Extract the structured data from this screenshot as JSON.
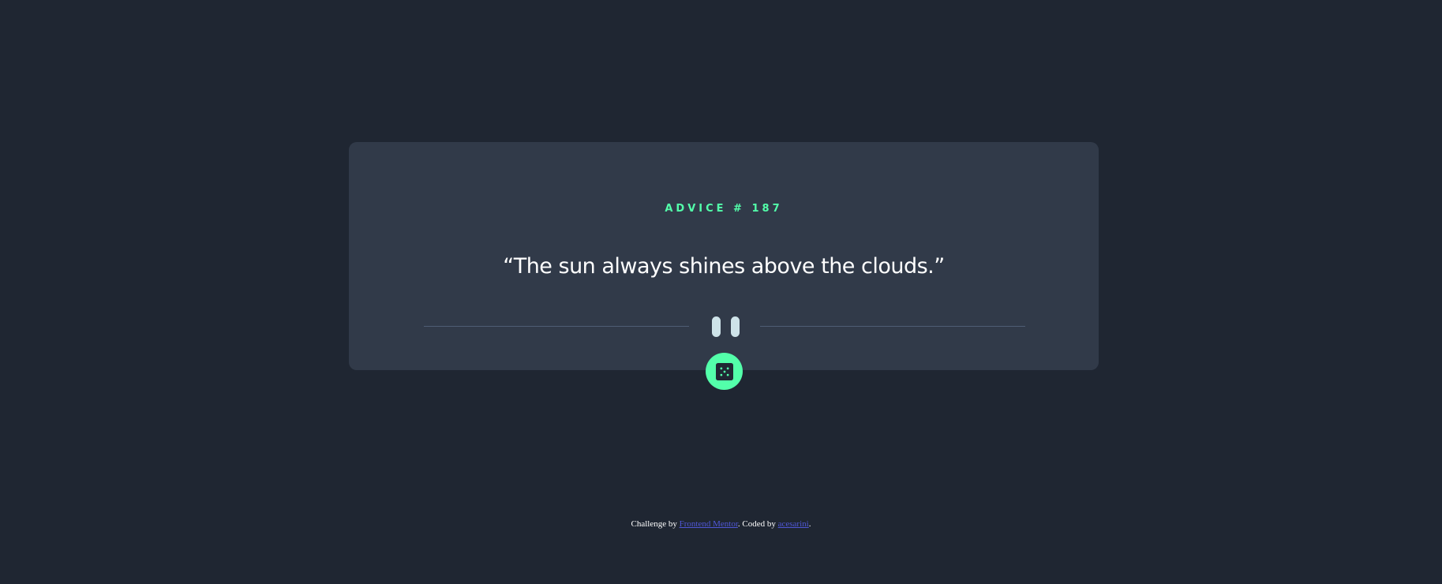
{
  "card": {
    "advice_id": "ADVICE # 187",
    "quote": "“The sun always shines above the clouds.”"
  },
  "icons": {
    "divider": "pause-icon",
    "button": "dice-icon"
  },
  "colors": {
    "background": "#1f2632",
    "card": "#313a49",
    "accent": "#53ffaa",
    "divider_line": "#4f5d74",
    "pause_bars": "#cee3e9",
    "link": "#4f57d6"
  },
  "footer": {
    "prefix": "Challenge by ",
    "link1": "Frontend Mentor",
    "middle": ". Coded by ",
    "link2": "acesarini",
    "suffix": "."
  }
}
